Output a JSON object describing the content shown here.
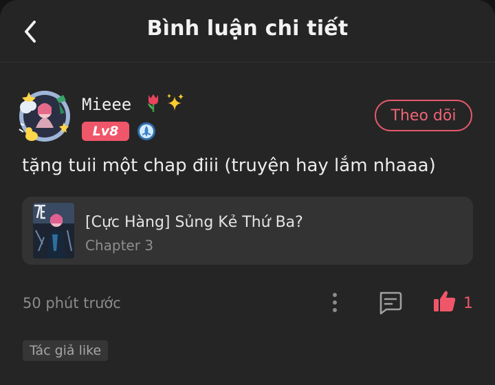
{
  "header": {
    "title": "Bình luận chi tiết"
  },
  "comment": {
    "username": "Mieee",
    "level_badge": "Lv8",
    "follow_label": "Theo dõi",
    "text": "tặng tuii một chap điii (truyện hay lắm nhaaa)",
    "timestamp": "50 phút trước",
    "like_count": "1",
    "author_tag": "Tác giả like"
  },
  "chapter_card": {
    "manga_title": "[Cực Hàng] Sủng Kẻ Thứ Ba?",
    "chapter": "Chapter 3"
  },
  "icons": {
    "back": "chevron-left-icon",
    "more": "vertical-dots-icon",
    "reply": "comment-icon",
    "like": "thumbs-up-icon",
    "rank": "rank-badge-icon"
  },
  "colors": {
    "background": "#252525",
    "accent": "#f0566a",
    "text_primary": "#ececec",
    "text_secondary": "#8c8c8c",
    "card": "#333333"
  }
}
